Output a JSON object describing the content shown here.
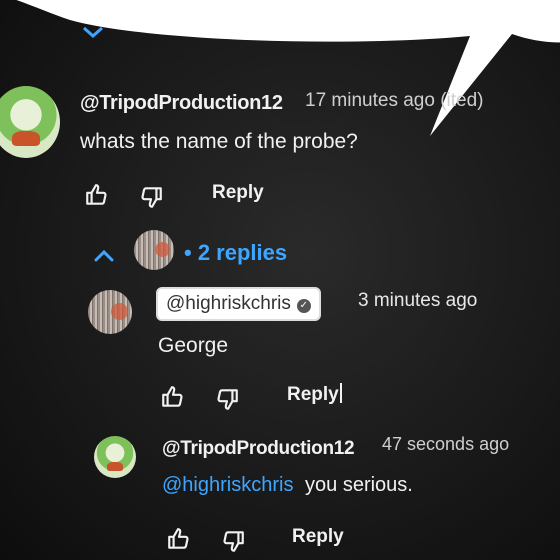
{
  "comment_main": {
    "author": "@TripodProduction12",
    "time": "17 minutes ago (",
    "edited": "ited)",
    "text": "whats the name of the probe?",
    "reply_label": "Reply"
  },
  "thread": {
    "replies_count": "2 replies"
  },
  "reply_1": {
    "author": "@highriskchris",
    "time": "3 minutes ago",
    "text": "George",
    "reply_label": "Reply"
  },
  "reply_2": {
    "author": "@TripodProduction12",
    "time": "47 seconds ago",
    "mention": "@highriskchris",
    "text": "you serious.",
    "reply_label": "Reply"
  },
  "icons": {
    "like": "thumbs-up-icon",
    "dislike": "thumbs-down-icon",
    "collapse": "chevron-up-icon",
    "verified": "check-circle-icon"
  },
  "colors": {
    "link_blue": "#3ea6ff",
    "text": "#f1f1f1",
    "background": "#1a1a1a"
  }
}
